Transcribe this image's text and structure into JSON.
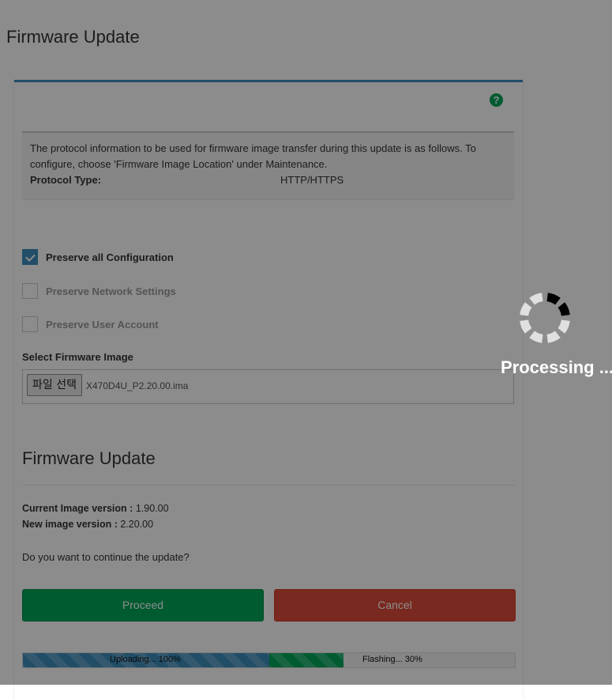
{
  "page": {
    "title": "Firmware Update"
  },
  "info": {
    "description": "The protocol information to be used for firmware image transfer during this update is as follows. To configure, choose 'Firmware Image Location' under Maintenance.",
    "protocol_label": "Protocol Type:",
    "protocol_value": "HTTP/HTTPS"
  },
  "options": [
    {
      "label": "Preserve all Configuration",
      "checked": true,
      "disabled": false
    },
    {
      "label": "Preserve Network Settings",
      "checked": false,
      "disabled": true
    },
    {
      "label": "Preserve User Account",
      "checked": false,
      "disabled": true
    }
  ],
  "file_select": {
    "label": "Select Firmware Image",
    "button_label": "파일 선택",
    "file_name": "X470D4U_P2.20.00.ima"
  },
  "update": {
    "title": "Firmware Update",
    "current_label": "Current Image version :",
    "current_value": "1.90.00",
    "new_label": "New image version :",
    "new_value": "2.20.00",
    "question": "Do you want to continue the update?",
    "proceed_label": "Proceed",
    "cancel_label": "Cancel"
  },
  "progress": {
    "upload_text": "Uploading... 100%",
    "upload_percent": 100,
    "flash_text": "Flashing... 30%",
    "flash_percent": 30
  },
  "overlay": {
    "text": "Processing ..."
  },
  "colors": {
    "accent": "#3c8dbc",
    "success": "#00a65a",
    "danger": "#dd4b39"
  }
}
